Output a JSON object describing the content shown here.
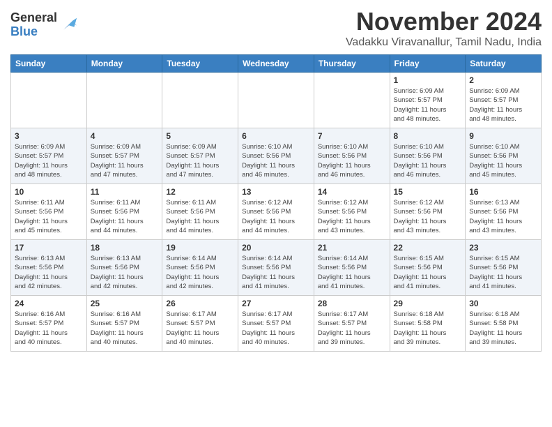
{
  "header": {
    "logo_line1": "General",
    "logo_line2": "Blue",
    "month": "November 2024",
    "location": "Vadakku Viravanallur, Tamil Nadu, India"
  },
  "days_of_week": [
    "Sunday",
    "Monday",
    "Tuesday",
    "Wednesday",
    "Thursday",
    "Friday",
    "Saturday"
  ],
  "weeks": [
    [
      {
        "day": "",
        "info": ""
      },
      {
        "day": "",
        "info": ""
      },
      {
        "day": "",
        "info": ""
      },
      {
        "day": "",
        "info": ""
      },
      {
        "day": "",
        "info": ""
      },
      {
        "day": "1",
        "info": "Sunrise: 6:09 AM\nSunset: 5:57 PM\nDaylight: 11 hours\nand 48 minutes."
      },
      {
        "day": "2",
        "info": "Sunrise: 6:09 AM\nSunset: 5:57 PM\nDaylight: 11 hours\nand 48 minutes."
      }
    ],
    [
      {
        "day": "3",
        "info": "Sunrise: 6:09 AM\nSunset: 5:57 PM\nDaylight: 11 hours\nand 48 minutes."
      },
      {
        "day": "4",
        "info": "Sunrise: 6:09 AM\nSunset: 5:57 PM\nDaylight: 11 hours\nand 47 minutes."
      },
      {
        "day": "5",
        "info": "Sunrise: 6:09 AM\nSunset: 5:57 PM\nDaylight: 11 hours\nand 47 minutes."
      },
      {
        "day": "6",
        "info": "Sunrise: 6:10 AM\nSunset: 5:56 PM\nDaylight: 11 hours\nand 46 minutes."
      },
      {
        "day": "7",
        "info": "Sunrise: 6:10 AM\nSunset: 5:56 PM\nDaylight: 11 hours\nand 46 minutes."
      },
      {
        "day": "8",
        "info": "Sunrise: 6:10 AM\nSunset: 5:56 PM\nDaylight: 11 hours\nand 46 minutes."
      },
      {
        "day": "9",
        "info": "Sunrise: 6:10 AM\nSunset: 5:56 PM\nDaylight: 11 hours\nand 45 minutes."
      }
    ],
    [
      {
        "day": "10",
        "info": "Sunrise: 6:11 AM\nSunset: 5:56 PM\nDaylight: 11 hours\nand 45 minutes."
      },
      {
        "day": "11",
        "info": "Sunrise: 6:11 AM\nSunset: 5:56 PM\nDaylight: 11 hours\nand 44 minutes."
      },
      {
        "day": "12",
        "info": "Sunrise: 6:11 AM\nSunset: 5:56 PM\nDaylight: 11 hours\nand 44 minutes."
      },
      {
        "day": "13",
        "info": "Sunrise: 6:12 AM\nSunset: 5:56 PM\nDaylight: 11 hours\nand 44 minutes."
      },
      {
        "day": "14",
        "info": "Sunrise: 6:12 AM\nSunset: 5:56 PM\nDaylight: 11 hours\nand 43 minutes."
      },
      {
        "day": "15",
        "info": "Sunrise: 6:12 AM\nSunset: 5:56 PM\nDaylight: 11 hours\nand 43 minutes."
      },
      {
        "day": "16",
        "info": "Sunrise: 6:13 AM\nSunset: 5:56 PM\nDaylight: 11 hours\nand 43 minutes."
      }
    ],
    [
      {
        "day": "17",
        "info": "Sunrise: 6:13 AM\nSunset: 5:56 PM\nDaylight: 11 hours\nand 42 minutes."
      },
      {
        "day": "18",
        "info": "Sunrise: 6:13 AM\nSunset: 5:56 PM\nDaylight: 11 hours\nand 42 minutes."
      },
      {
        "day": "19",
        "info": "Sunrise: 6:14 AM\nSunset: 5:56 PM\nDaylight: 11 hours\nand 42 minutes."
      },
      {
        "day": "20",
        "info": "Sunrise: 6:14 AM\nSunset: 5:56 PM\nDaylight: 11 hours\nand 41 minutes."
      },
      {
        "day": "21",
        "info": "Sunrise: 6:14 AM\nSunset: 5:56 PM\nDaylight: 11 hours\nand 41 minutes."
      },
      {
        "day": "22",
        "info": "Sunrise: 6:15 AM\nSunset: 5:56 PM\nDaylight: 11 hours\nand 41 minutes."
      },
      {
        "day": "23",
        "info": "Sunrise: 6:15 AM\nSunset: 5:56 PM\nDaylight: 11 hours\nand 41 minutes."
      }
    ],
    [
      {
        "day": "24",
        "info": "Sunrise: 6:16 AM\nSunset: 5:57 PM\nDaylight: 11 hours\nand 40 minutes."
      },
      {
        "day": "25",
        "info": "Sunrise: 6:16 AM\nSunset: 5:57 PM\nDaylight: 11 hours\nand 40 minutes."
      },
      {
        "day": "26",
        "info": "Sunrise: 6:17 AM\nSunset: 5:57 PM\nDaylight: 11 hours\nand 40 minutes."
      },
      {
        "day": "27",
        "info": "Sunrise: 6:17 AM\nSunset: 5:57 PM\nDaylight: 11 hours\nand 40 minutes."
      },
      {
        "day": "28",
        "info": "Sunrise: 6:17 AM\nSunset: 5:57 PM\nDaylight: 11 hours\nand 39 minutes."
      },
      {
        "day": "29",
        "info": "Sunrise: 6:18 AM\nSunset: 5:58 PM\nDaylight: 11 hours\nand 39 minutes."
      },
      {
        "day": "30",
        "info": "Sunrise: 6:18 AM\nSunset: 5:58 PM\nDaylight: 11 hours\nand 39 minutes."
      }
    ]
  ]
}
